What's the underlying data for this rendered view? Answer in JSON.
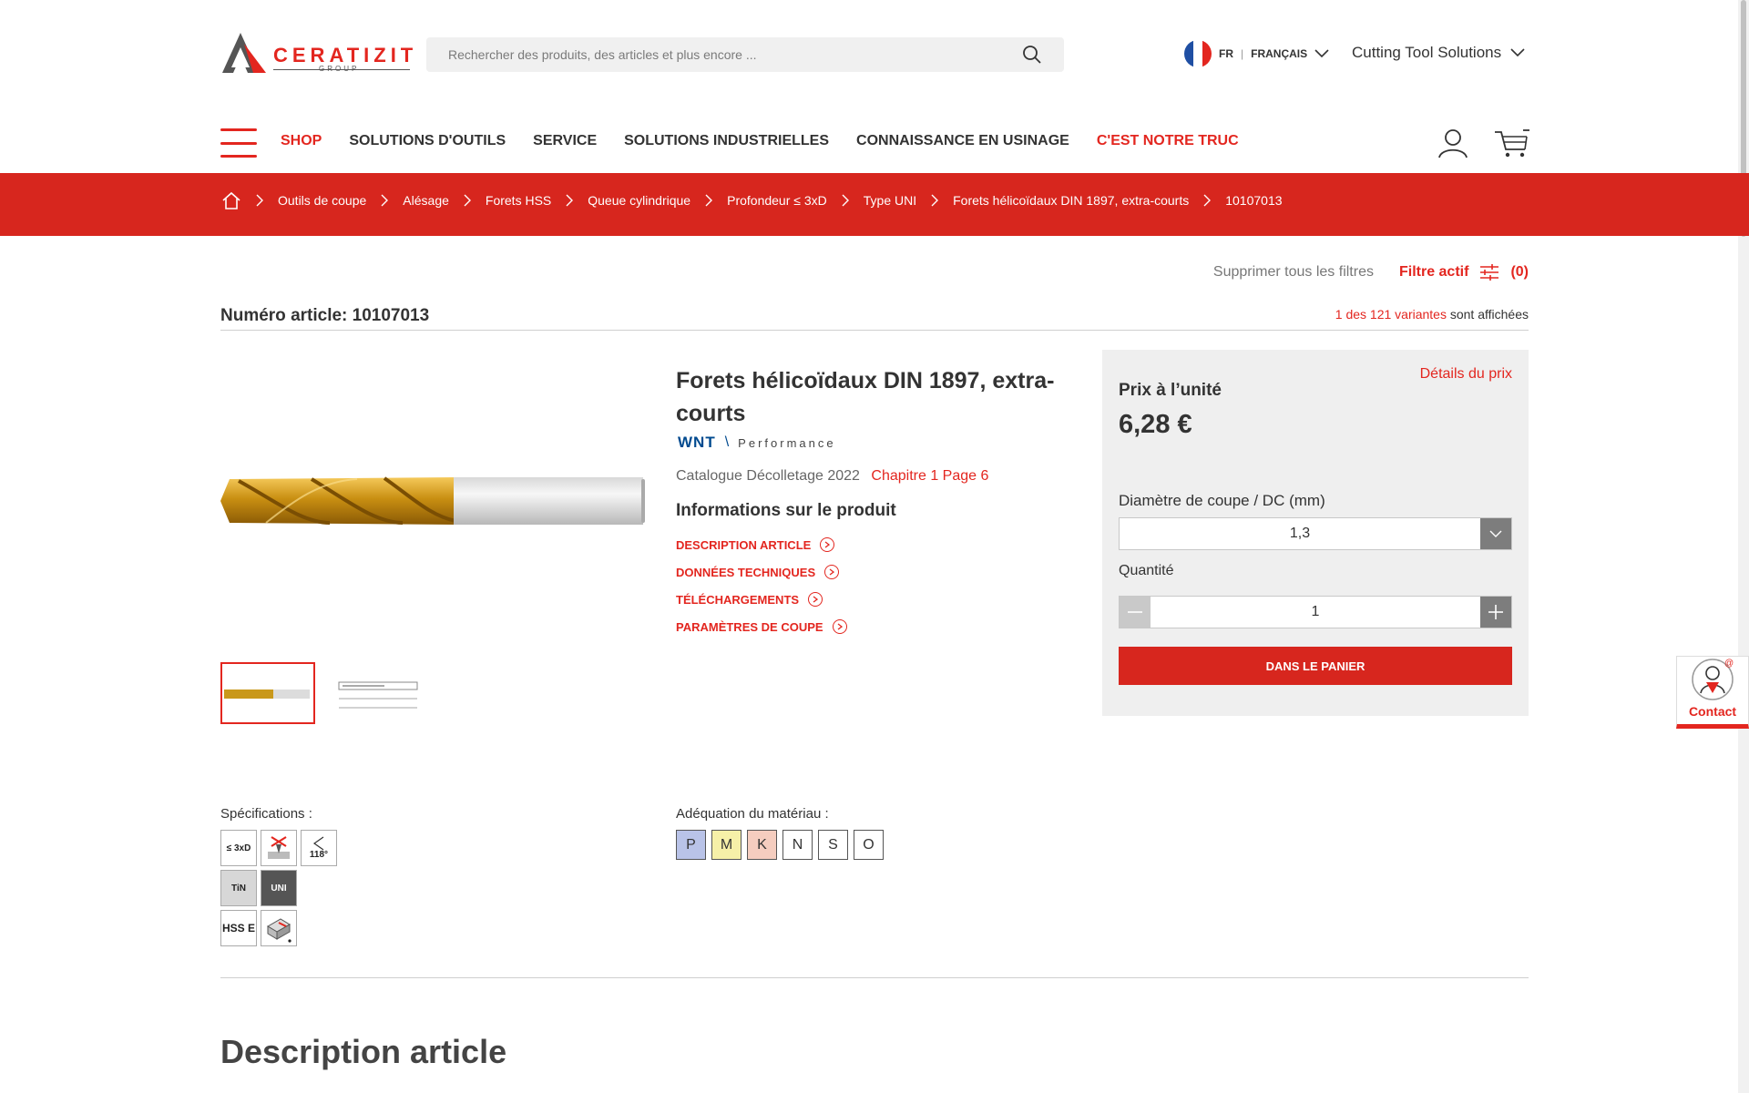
{
  "header": {
    "logo_text": "CERATIZIT",
    "logo_group": "GROUP",
    "search_placeholder": "Rechercher des produits, des articles et plus encore ...",
    "lang_code": "FR",
    "lang_name": "FRANÇAIS",
    "solutions": "Cutting Tool Solutions"
  },
  "nav": {
    "items": [
      "SHOP",
      "SOLUTIONS D'OUTILS",
      "SERVICE",
      "SOLUTIONS INDUSTRIELLES",
      "CONNAISSANCE EN USINAGE",
      "C'EST NOTRE TRUC"
    ]
  },
  "breadcrumb": [
    "Outils de coupe",
    "Alésage",
    "Forets HSS",
    "Queue cylindrique",
    "Profondeur ≤ 3xD",
    "Type UNI",
    "Forets hélicoïdaux DIN 1897, extra-courts",
    "10107013"
  ],
  "filters": {
    "clear": "Supprimer tous les filtres",
    "active": "Filtre actif",
    "count": "(0)"
  },
  "article": {
    "number": "Numéro article: 10107013",
    "variants_link": "1 des 121 variantes",
    "variants_suffix": "sont affichées"
  },
  "product": {
    "title": "Forets hélicoïdaux DIN 1897, extra-courts",
    "brand": "WNT",
    "brand_line": "Performance",
    "catalogue": "Catalogue Décolletage 2022",
    "catalogue_link": "Chapitre 1 Page 6",
    "info_title": "Informations sur le produit",
    "info_links": [
      "DESCRIPTION ARTICLE",
      "DONNÉES TECHNIQUES",
      "TÉLÉCHARGEMENTS",
      "PARAMÈTRES DE COUPE"
    ]
  },
  "price": {
    "details": "Détails du prix",
    "label": "Prix à l’unité",
    "value": "6,28 €",
    "dc_label": "Diamètre de coupe / DC (mm)",
    "dc_value": "1,3",
    "qty_label": "Quantité",
    "qty_value": "1",
    "add_to_cart": "DANS LE PANIER"
  },
  "contact": "Contact",
  "specs": {
    "label": "Spécifications :",
    "items": [
      "≤ 3xD",
      "",
      "118°",
      "TiN",
      "UNI",
      "HSS E",
      ""
    ]
  },
  "materials": {
    "label": "Adéquation du matériau :",
    "items": [
      {
        "code": "P",
        "color": "#b9c3e8"
      },
      {
        "code": "M",
        "color": "#f6f0a8"
      },
      {
        "code": "K",
        "color": "#f5cdbf"
      },
      {
        "code": "N",
        "color": "#ffffff"
      },
      {
        "code": "S",
        "color": "#ffffff"
      },
      {
        "code": "O",
        "color": "#ffffff"
      }
    ]
  },
  "description_title": "Description article",
  "colors": {
    "brand_red": "#e3261f",
    "breadcrumb_red": "#d7261e",
    "wnt_blue": "#004a8f"
  }
}
